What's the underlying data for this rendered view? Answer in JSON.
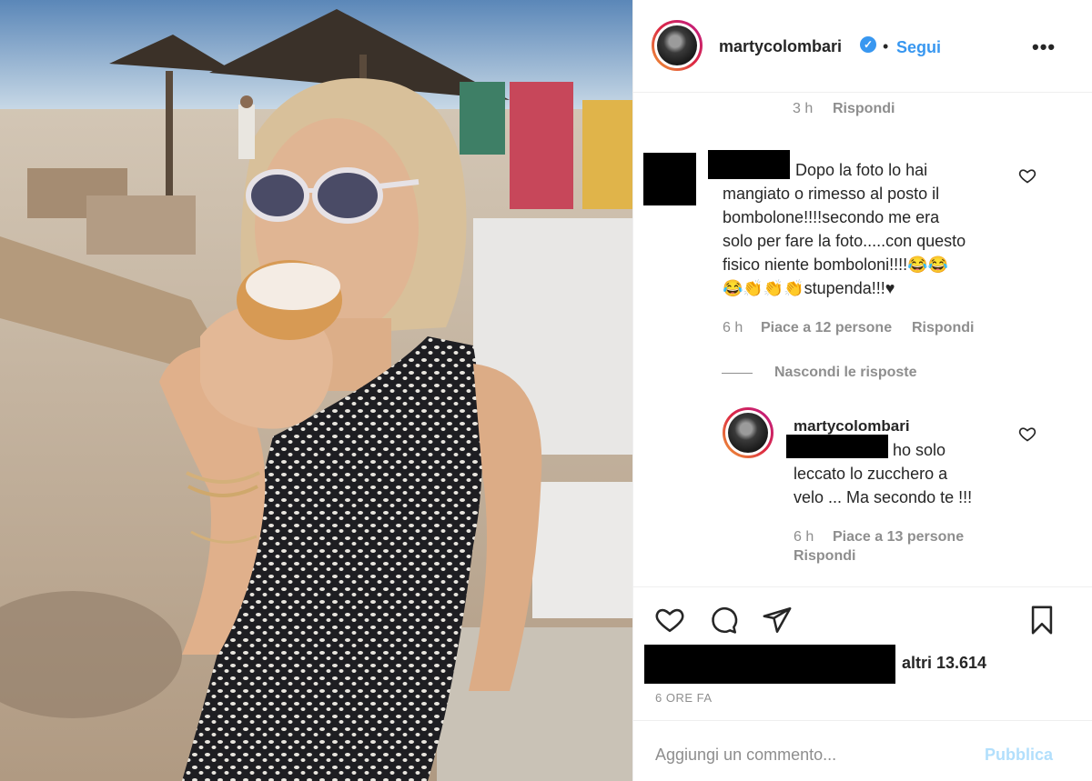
{
  "post": {
    "image_alt": "Donna bionda con occhiali da sole che morde un bombolone in spiaggia"
  },
  "header": {
    "username": "martycolombari",
    "verified_icon": "verified-badge-icon",
    "separator": "•",
    "follow_label": "Segui",
    "more_label": "•••"
  },
  "comments": [
    {
      "time": "3 h",
      "reply_label": "Rispondi"
    },
    {
      "lines": [
        "Dopo la foto lo hai",
        "mangiato o rimesso al posto il",
        "bombolone!!!!secondo me era",
        "solo per fare la foto.....con questo",
        "fisico niente bomboloni!!!!😂😂",
        "😂👏👏👏stupenda!!!♥"
      ],
      "time": "6 h",
      "likes": "Piace a 12 persone",
      "reply_label": "Rispondi"
    }
  ],
  "hide_replies_label": "Nascondi le risposte",
  "reply": {
    "username": "martycolombari",
    "lines": [
      "ho solo",
      "leccato lo zucchero a",
      "velo ... Ma secondo te !!!"
    ],
    "time": "6 h",
    "likes": "Piace a 13 persone",
    "reply_label": "Rispondi"
  },
  "footer": {
    "likes_others": "altri 13.614",
    "timestamp": "6 ORE FA",
    "comment_placeholder": "Aggiungi un commento...",
    "publish_label": "Pubblica"
  },
  "colors": {
    "link_blue": "#3897f0",
    "publish_disabled": "#b2dffc",
    "muted": "#8e8e8e"
  }
}
